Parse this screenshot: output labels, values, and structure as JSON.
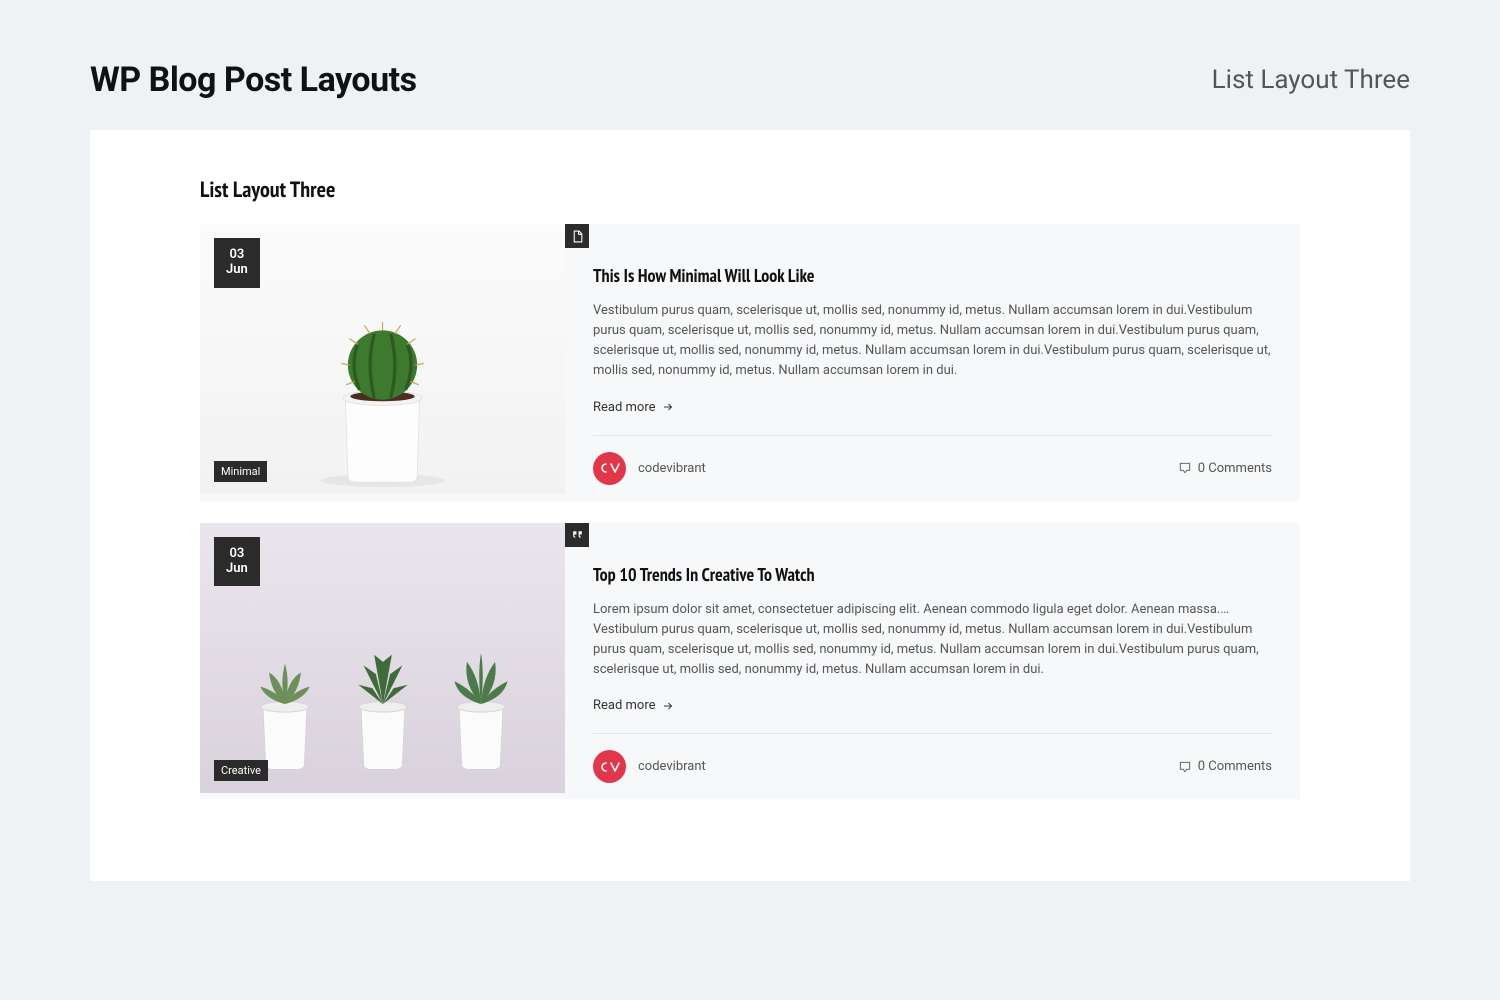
{
  "header": {
    "title": "WP Blog Post Layouts",
    "subtitle": "List Layout Three"
  },
  "block": {
    "title": "List Layout Three"
  },
  "posts": [
    {
      "day": "03",
      "month": "Jun",
      "category": "Minimal",
      "title": "This Is How Minimal Will Look Like",
      "excerpt": "Vestibulum purus quam, scelerisque ut, mollis sed, nonummy id, metus. Nullam accumsan lorem in dui.Vestibulum purus quam, scelerisque ut, mollis sed, nonummy id, metus. Nullam accumsan lorem in dui.Vestibulum purus quam, scelerisque ut, mollis sed, nonummy id, metus. Nullam accumsan lorem in dui.Vestibulum purus quam, scelerisque ut, mollis sed, nonummy id, metus. Nullam accumsan lorem in dui.",
      "read_more": "Read more",
      "author": "codevibrant",
      "comments": "0 Comments"
    },
    {
      "day": "03",
      "month": "Jun",
      "category": "Creative",
      "title": "Top 10 Trends In Creative To Watch",
      "excerpt": "Lorem ipsum dolor sit amet, consectetuer adipiscing elit. Aenean commodo ligula eget dolor. Aenean massa.…Vestibulum purus quam, scelerisque ut, mollis sed, nonummy id, metus. Nullam accumsan lorem in dui.Vestibulum purus quam, scelerisque ut, mollis sed, nonummy id, metus. Nullam accumsan lorem in dui.Vestibulum purus quam, scelerisque ut, mollis sed, nonummy id, metus. Nullam accumsan lorem in dui.",
      "read_more": "Read more",
      "author": "codevibrant",
      "comments": "0 Comments"
    }
  ]
}
